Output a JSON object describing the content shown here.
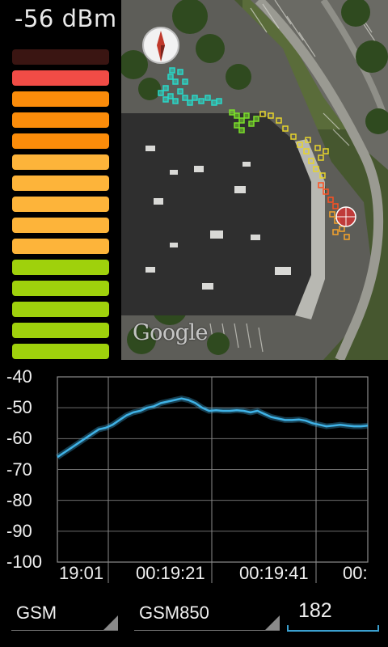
{
  "signal": {
    "reading": "-56 dBm"
  },
  "meter": {
    "levels": [
      {
        "color": "#3a1512"
      },
      {
        "color": "#f14c46"
      },
      {
        "color": "#fb8c0a"
      },
      {
        "color": "#fb8c0a"
      },
      {
        "color": "#fb8c0a"
      },
      {
        "color": "#fdb43a"
      },
      {
        "color": "#fdb43a"
      },
      {
        "color": "#fdb43a"
      },
      {
        "color": "#fdb43a"
      },
      {
        "color": "#fdb43a"
      },
      {
        "color": "#9fd10c"
      },
      {
        "color": "#9fd10c"
      },
      {
        "color": "#9fd10c"
      },
      {
        "color": "#9fd10c"
      },
      {
        "color": "#9fd10c"
      }
    ]
  },
  "map": {
    "attribution": "Google",
    "compass_icon": "compass-icon",
    "location_icon": "location-marker-icon"
  },
  "chart_data": {
    "type": "line",
    "ylim": [
      -100,
      -40
    ],
    "yticks": [
      "-40",
      "-50",
      "-60",
      "-70",
      "-80",
      "-90",
      "-100"
    ],
    "xtick_labels": [
      "19:01",
      "00:19:21",
      "00:19:41",
      "00:"
    ],
    "series": [
      {
        "color": "#3fb2e6",
        "values": [
          -66,
          -64.5,
          -63,
          -61.5,
          -60,
          -58.5,
          -57,
          -56.5,
          -55.5,
          -54,
          -52.5,
          -51.5,
          -51,
          -50,
          -49.5,
          -48.5,
          -48,
          -47.5,
          -47,
          -47.5,
          -48.5,
          -50,
          -51,
          -50.8,
          -51,
          -51,
          -50.8,
          -51,
          -51.5,
          -51,
          -52,
          -53,
          -53.5,
          -54,
          -54,
          -53.8,
          -54.2,
          -55,
          -55.5,
          -56,
          -55.8,
          -55.5,
          -55.8,
          -56,
          -56,
          -55.8
        ]
      }
    ]
  },
  "controls": {
    "network_type": "GSM",
    "band": "GSM850",
    "channel": "182"
  }
}
